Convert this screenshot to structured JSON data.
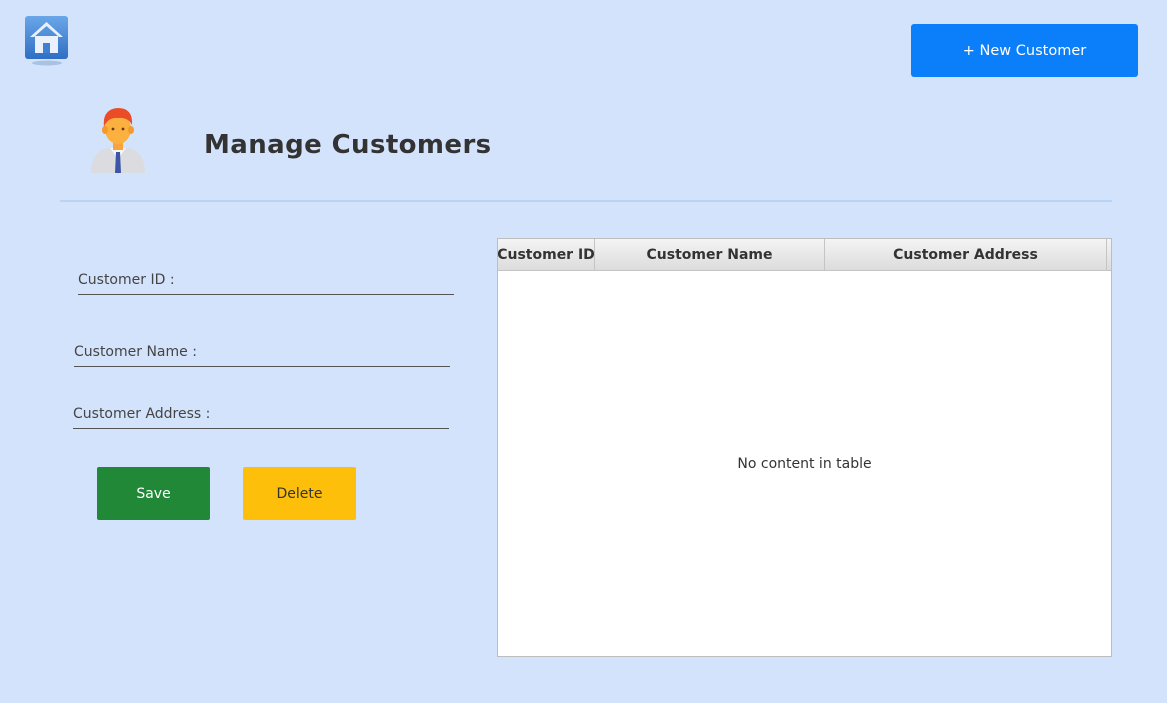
{
  "header": {
    "home_icon": "home-icon",
    "new_customer_label": "+ New Customer",
    "avatar_icon": "user-avatar-icon",
    "title": "Manage Customers"
  },
  "form": {
    "customer_id_label": "Customer ID :",
    "customer_id_value": "",
    "customer_name_label": "Customer Name :",
    "customer_name_value": "",
    "customer_address_label": "Customer Address :",
    "customer_address_value": "",
    "save_label": "Save",
    "delete_label": "Delete"
  },
  "table": {
    "columns": [
      "Customer ID",
      "Customer Name",
      "Customer Address"
    ],
    "rows": [],
    "empty_message": "No content in table"
  },
  "colors": {
    "background": "#d4e3fc",
    "new_button": "#0a7ff9",
    "save_button": "#218838",
    "delete_button": "#fdbf0a"
  }
}
